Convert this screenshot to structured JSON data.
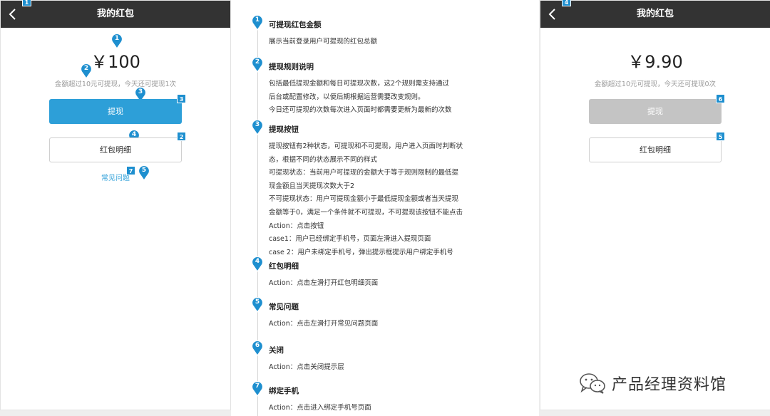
{
  "left_phone": {
    "nav_title": "我的红包",
    "amount": "￥100",
    "note": "金额超过10元可提现，今天还可提现1次",
    "withdraw_button": "提现",
    "detail_button": "红包明细",
    "faq_link": "常见问题"
  },
  "right_phone": {
    "nav_title": "我的红包",
    "amount": "￥9.90",
    "note": "金额超过10元可提现，今天还可提现0次",
    "withdraw_button": "提现",
    "detail_button": "红包明细"
  },
  "markers": {
    "left_top": "1",
    "left_pin_amount": "1",
    "left_pin_note": "2",
    "left_pin_withdraw": "3",
    "left_sq_withdraw": "3",
    "left_pin_detail": "4",
    "left_sq_detail": "2",
    "left_sq_faq": "7",
    "left_pin_faq": "5",
    "right_top": "4",
    "right_sq_withdraw": "6",
    "right_sq_detail": "5"
  },
  "spec": [
    {
      "num": "1",
      "title": "可提现红包金额",
      "lines": [
        "展示当前登录用户可提现的红包总额"
      ]
    },
    {
      "num": "2",
      "title": "提现规则说明",
      "lines": [
        "包括最低提现金额和每日可提现次数，这2个规则需支持通过",
        "后台或配置修改，以便后期根据运营需要改变规则。",
        "今日还可提现的次数每次进入页面时都需要更新为最新的次数"
      ]
    },
    {
      "num": "3",
      "title": "提现按钮",
      "lines": [
        "提现按钮有2种状态，可提现和不可提现，用户进入页面时判断状",
        "态，根据不同的状态展示不同的样式",
        "可提现状态：当前用户可提现的金额大于等于规则限制的最低提",
        "现金额且当天提现次数大于2",
        "不可提现状态：用户可提现金额小于最低提现金额或者当天提现",
        "金额等于0，满足一个条件就不可提现，不可提现该按钮不能点击",
        "Action：点击按钮",
        "case1：用户已经绑定手机号，页面左滑进入提现页面",
        "case 2：用户未绑定手机号，弹出提示框提示用户绑定手机号"
      ]
    },
    {
      "num": "4",
      "title": "红包明细",
      "lines": [
        "Action：点击左滑打开红包明细页面"
      ]
    },
    {
      "num": "5",
      "title": "常见问题",
      "lines": [
        "Action：点击左滑打开常见问题页面"
      ]
    },
    {
      "num": "6",
      "title": "关闭",
      "lines": [
        "Action：点击关闭提示层"
      ]
    },
    {
      "num": "7",
      "title": "绑定手机",
      "lines": [
        "Action：点击进入绑定手机号页面"
      ]
    }
  ],
  "watermark": "产品经理资料馆",
  "colors": {
    "accent": "#2d9fd8",
    "marker": "#1e8fcf",
    "navbar": "#333333",
    "disabled": "#c4c4c4"
  }
}
